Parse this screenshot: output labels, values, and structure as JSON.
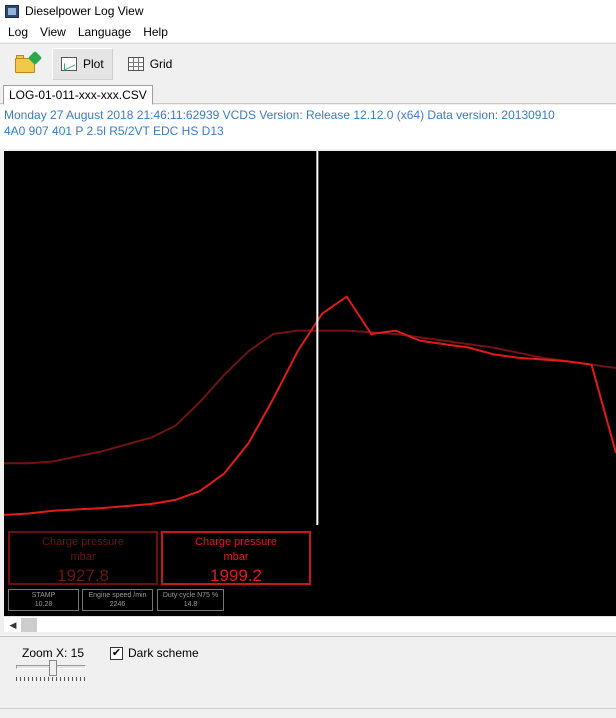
{
  "window": {
    "title": "Dieselpower Log View"
  },
  "menu": {
    "items": [
      "Log",
      "View",
      "Language",
      "Help"
    ]
  },
  "toolbar": {
    "plot_label": "Plot",
    "grid_label": "Grid"
  },
  "tab": {
    "label": "LOG-01-011-xxx-xxx.CSV"
  },
  "info": {
    "line1": "Monday 27 August 2018 21:46:11:62939 VCDS Version: Release 12.12.0 (x64) Data version: 20130910",
    "line2": "4A0 907 401 P  2.5l R5/2VT EDC  HS D13"
  },
  "gauges": {
    "dim": {
      "label1": "Charge pressure",
      "label2": "mbar",
      "value": "1927.8"
    },
    "bright": {
      "label1": "Charge pressure",
      "label2": "mbar",
      "value": "1999.2"
    }
  },
  "small_gauges": {
    "stamp": {
      "label": "STAMP",
      "value": "10.28"
    },
    "speed": {
      "label": "Engine speed /min",
      "value": "2246"
    },
    "duty": {
      "label": "Duty cycle N75 %",
      "value": "14.8"
    }
  },
  "bottom": {
    "zoom_label": "Zoom X: 15",
    "dark_scheme_label": "Dark scheme",
    "dark_scheme_checked": true
  },
  "colors": {
    "plot_background": "#000000",
    "series_bright": "#e31a1a",
    "series_dim": "#6f1313",
    "cursor": "#ffffff",
    "info_text": "#3a7cc4"
  },
  "chart_data": {
    "type": "line",
    "x": [
      0,
      2,
      4,
      6,
      8,
      10,
      12,
      14,
      16,
      18,
      20,
      22,
      24,
      26,
      28,
      30,
      32,
      34,
      36,
      38,
      40,
      42,
      44,
      46,
      48,
      50
    ],
    "series": [
      {
        "key": "bright",
        "values": [
          0.18,
          0.22,
          0.3,
          0.34,
          0.38,
          0.44,
          0.5,
          0.62,
          0.88,
          1.4,
          2.3,
          3.6,
          5.0,
          6.1,
          6.6,
          5.5,
          5.6,
          5.3,
          5.2,
          5.1,
          4.9,
          4.8,
          4.75,
          4.7,
          4.6,
          2.0
        ]
      },
      {
        "key": "dim",
        "values": [
          1.7,
          1.7,
          1.75,
          1.9,
          2.05,
          2.25,
          2.45,
          2.8,
          3.5,
          4.3,
          5.0,
          5.5,
          5.6,
          5.6,
          5.6,
          5.55,
          5.5,
          5.4,
          5.3,
          5.2,
          5.1,
          4.95,
          4.8,
          4.7,
          4.6,
          4.5
        ]
      }
    ],
    "cursor_x": 25.6,
    "xlim": [
      0,
      50
    ],
    "ylim": [
      0,
      10
    ],
    "grid": false
  }
}
